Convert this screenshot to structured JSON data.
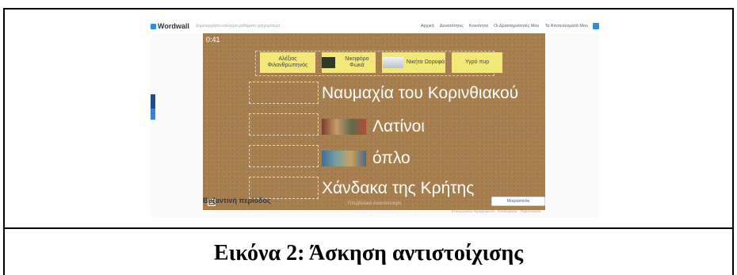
{
  "header": {
    "logo": "Wordwall",
    "tagline": "Δημιουργήστε καλύτερα μαθήματα γρηγορότερα",
    "nav": [
      "Αρχική",
      "Δυνατότητες",
      "Κοινότητα",
      "Οι Δραστηριότητές Μου",
      "Τα Αποτελέσματά Μου"
    ]
  },
  "game": {
    "timer": "0:41",
    "cards": [
      {
        "label": "Αλέξιος Φιλανθρωπηνός",
        "has_image": false
      },
      {
        "label": "Νικηφόρο Φωκά",
        "has_image": true
      },
      {
        "label": "Νικήτα Ωορυφά",
        "has_image": true
      },
      {
        "label": "Υγρό πυρ",
        "has_image": false
      }
    ],
    "statements": [
      {
        "text": "Ναυμαχία του Κορινθιακού",
        "has_image": false
      },
      {
        "text": "Λατίνοι",
        "has_image": true
      },
      {
        "text": "όπλο",
        "has_image": true
      },
      {
        "text": "Χάνδακα της Κρήτης",
        "has_image": false
      }
    ],
    "footer": "Υπερβολικά Αναντιστοιχία"
  },
  "info": {
    "title": "Βυζαντινή περίοδος",
    "share_label": "Μοιραστείτε",
    "meta": "Επεξεργασία περιεχομένου · Επαναφορά · Περισσότερα"
  },
  "caption": "Εικόνα 2: Άσκηση αντιστοίχισης",
  "colors": {
    "board": "#a8804f",
    "card": "#f2e87a",
    "accent": "#2a8de0"
  }
}
